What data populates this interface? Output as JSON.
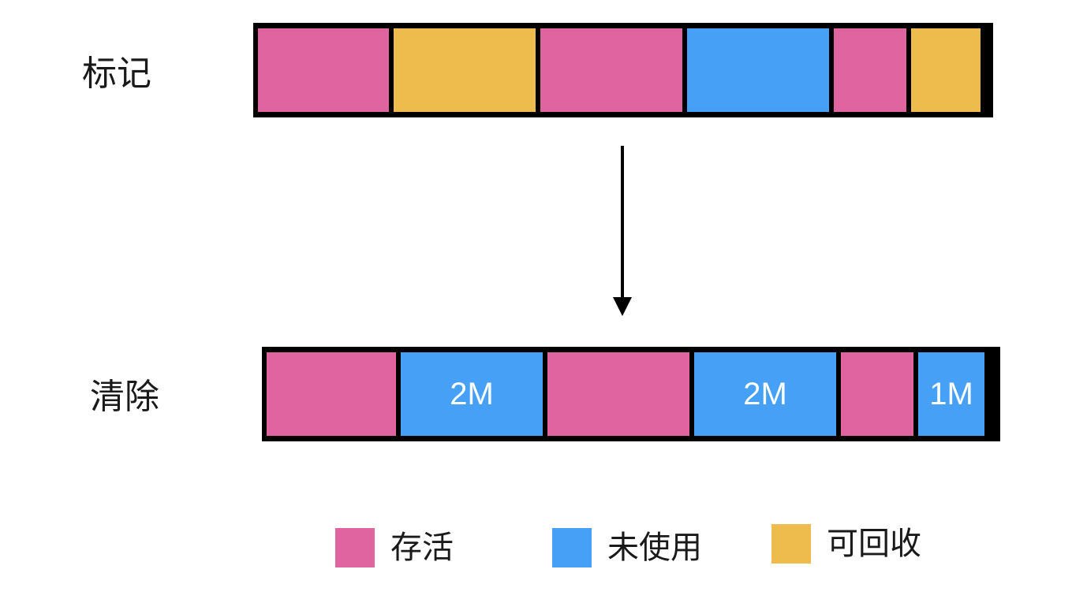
{
  "colors": {
    "alive": "#df649f",
    "unused": "#45a0f6",
    "reclaimable": "#eebb4d"
  },
  "mark": {
    "label": "标记",
    "blocks": [
      {
        "state": "alive",
        "text": ""
      },
      {
        "state": "reclaimable",
        "text": ""
      },
      {
        "state": "alive",
        "text": ""
      },
      {
        "state": "unused",
        "text": ""
      },
      {
        "state": "alive",
        "text": ""
      },
      {
        "state": "reclaimable",
        "text": ""
      }
    ]
  },
  "sweep": {
    "label": "清除",
    "blocks": [
      {
        "state": "alive",
        "text": ""
      },
      {
        "state": "unused",
        "text": "2M"
      },
      {
        "state": "alive",
        "text": ""
      },
      {
        "state": "unused",
        "text": "2M"
      },
      {
        "state": "alive",
        "text": ""
      },
      {
        "state": "unused",
        "text": "1M"
      }
    ]
  },
  "legend": [
    {
      "state": "alive",
      "label": "存活"
    },
    {
      "state": "unused",
      "label": "未使用"
    },
    {
      "state": "reclaimable",
      "label": "可回收"
    }
  ]
}
